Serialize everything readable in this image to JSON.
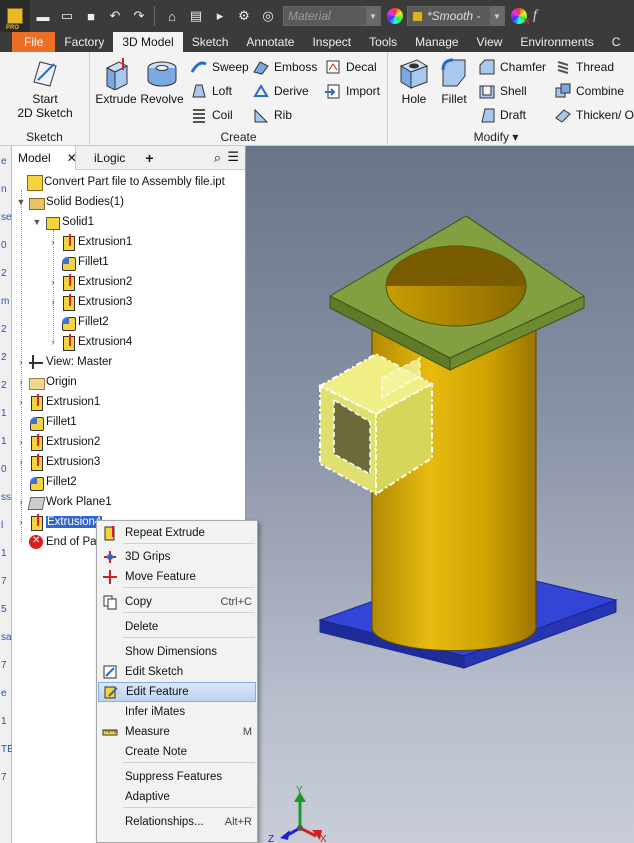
{
  "qat": {
    "material_placeholder": "Material",
    "appearance_value": "*Smooth -",
    "fx_symbol": "f"
  },
  "tabs": [
    "File",
    "Factory",
    "3D Model",
    "Sketch",
    "Annotate",
    "Inspect",
    "Tools",
    "Manage",
    "View",
    "Environments",
    "C"
  ],
  "active_tab": "3D Model",
  "ribbon": {
    "sketch_panel": {
      "label": "Sketch",
      "start_sketch": "Start",
      "start_sketch_2": "2D Sketch"
    },
    "create_panel": {
      "label": "Create",
      "extrude": "Extrude",
      "revolve": "Revolve",
      "sweep": "Sweep",
      "loft": "Loft",
      "coil": "Coil",
      "emboss": "Emboss",
      "derive": "Derive",
      "rib": "Rib",
      "decal": "Decal",
      "import": "Import"
    },
    "modify_panel": {
      "label": "Modify",
      "hole": "Hole",
      "fillet": "Fillet",
      "chamfer": "Chamfer",
      "shell": "Shell",
      "draft": "Draft",
      "thread": "Thread",
      "combine": "Combine",
      "thicken": "Thicken/ Of"
    }
  },
  "browser": {
    "tab_model": "Model",
    "tab_ilogic": "iLogic",
    "add_tab": "+",
    "tree": {
      "root": "Convert Part file to Assembly file.ipt",
      "solid_bodies": "Solid Bodies(1)",
      "solid1": "Solid1",
      "solid_children": [
        "Extrusion1",
        "Fillet1",
        "Extrusion2",
        "Extrusion3",
        "Fillet2",
        "Extrusion4"
      ],
      "view_master": "View: Master",
      "origin": "Origin",
      "features": [
        "Extrusion1",
        "Fillet1",
        "Extrusion2",
        "Extrusion3",
        "Fillet2"
      ],
      "work_plane": "Work Plane1",
      "selected_feature": "Extrusion4",
      "end_of_part": "End of Par"
    }
  },
  "left_strip": [
    "e",
    "n",
    "se",
    "0",
    "2",
    "m",
    "2",
    "2",
    "2",
    "1",
    "1",
    "0",
    "ss",
    "l",
    "1",
    "7",
    "5",
    "sa",
    "7",
    "e",
    "1",
    "TE",
    "7"
  ],
  "context_menu": {
    "items": [
      {
        "label": "Repeat Extrude",
        "shortcut": ""
      },
      {
        "label": "3D Grips",
        "shortcut": ""
      },
      {
        "label": "Move Feature",
        "shortcut": ""
      },
      {
        "label": "Copy",
        "shortcut": "Ctrl+C"
      },
      {
        "label": "Delete",
        "shortcut": ""
      },
      {
        "label": "Show Dimensions",
        "shortcut": ""
      },
      {
        "label": "Edit Sketch",
        "shortcut": ""
      },
      {
        "label": "Edit Feature",
        "shortcut": ""
      },
      {
        "label": "Infer iMates",
        "shortcut": ""
      },
      {
        "label": "Measure",
        "shortcut": "M"
      },
      {
        "label": "Create Note",
        "shortcut": ""
      },
      {
        "label": "Suppress Features",
        "shortcut": ""
      },
      {
        "label": "Adaptive",
        "shortcut": ""
      },
      {
        "label": "Relationships...",
        "shortcut": "Alt+R"
      }
    ],
    "highlighted": "Edit Feature"
  },
  "triad": {
    "x": "X",
    "y": "Y",
    "z": "Z"
  },
  "colors": {
    "file_tab": "#ec6f25",
    "part_body": "#c9a200",
    "top_plate": "#7c9a3a",
    "base_plate": "#2a3fc8",
    "selection_highlight": "#f2f27a",
    "menu_highlight": "#bcd3f0",
    "tree_selection": "#3366cc"
  }
}
